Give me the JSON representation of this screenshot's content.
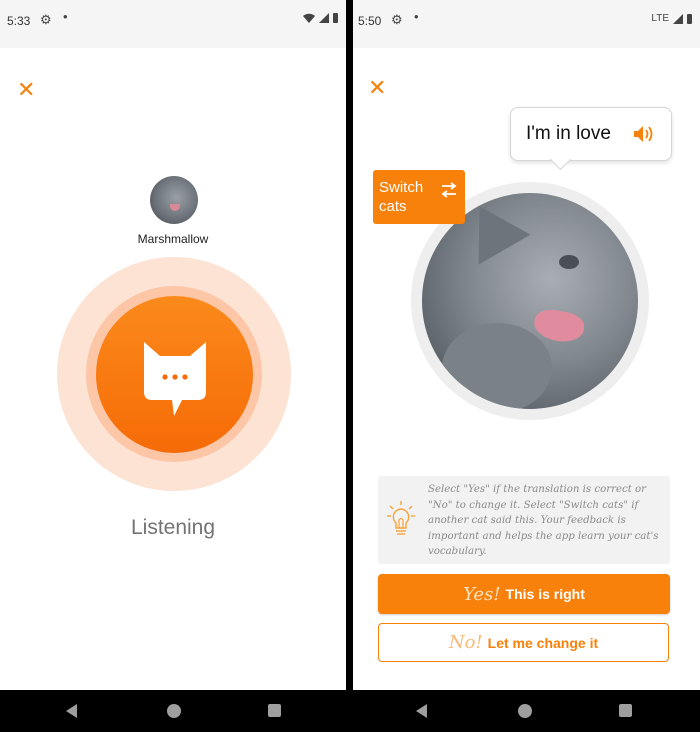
{
  "left": {
    "status": {
      "time": "5:33"
    },
    "cat_name": "Marshmallow",
    "listening_label": "Listening"
  },
  "right": {
    "status": {
      "time": "5:50",
      "network": "LTE"
    },
    "bubble_text": "I'm in love",
    "switch_label": "Switch cats",
    "hint_text": "Select \"Yes\" if the translation is correct or \"No\" to change it. Select \"Switch cats\" if another cat said this. Your feedback is important and helps the app learn your cat's vocabulary.",
    "yes_button": {
      "handwritten": "Yes!",
      "label": "This is right"
    },
    "no_button": {
      "handwritten": "No!",
      "label": "Let me change it"
    }
  },
  "icons": {
    "close": "close-icon",
    "gear": "gear-icon",
    "speaker": "speaker-icon",
    "switch": "swap-arrows-icon",
    "bulb": "lightbulb-icon",
    "cat": "cat-chat-icon"
  },
  "colors": {
    "accent": "#f7810a",
    "ring_outer": "#fde3d4",
    "ring_mid": "#fcc6a7",
    "hint_bg": "#f2f2f2"
  }
}
